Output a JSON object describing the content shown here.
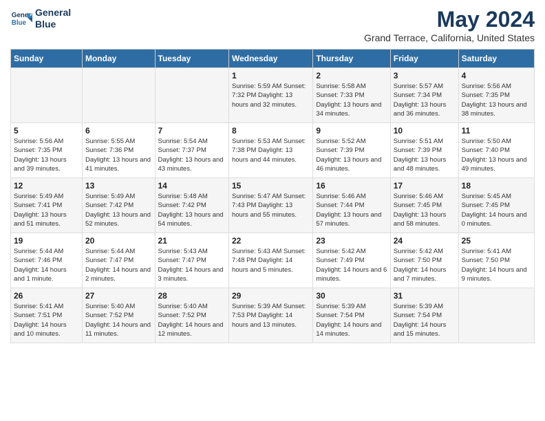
{
  "logo": {
    "line1": "General",
    "line2": "Blue"
  },
  "title": "May 2024",
  "subtitle": "Grand Terrace, California, United States",
  "days_of_week": [
    "Sunday",
    "Monday",
    "Tuesday",
    "Wednesday",
    "Thursday",
    "Friday",
    "Saturday"
  ],
  "weeks": [
    [
      {
        "day": "",
        "info": ""
      },
      {
        "day": "",
        "info": ""
      },
      {
        "day": "",
        "info": ""
      },
      {
        "day": "1",
        "info": "Sunrise: 5:59 AM\nSunset: 7:32 PM\nDaylight: 13 hours\nand 32 minutes."
      },
      {
        "day": "2",
        "info": "Sunrise: 5:58 AM\nSunset: 7:33 PM\nDaylight: 13 hours\nand 34 minutes."
      },
      {
        "day": "3",
        "info": "Sunrise: 5:57 AM\nSunset: 7:34 PM\nDaylight: 13 hours\nand 36 minutes."
      },
      {
        "day": "4",
        "info": "Sunrise: 5:56 AM\nSunset: 7:35 PM\nDaylight: 13 hours\nand 38 minutes."
      }
    ],
    [
      {
        "day": "5",
        "info": "Sunrise: 5:56 AM\nSunset: 7:35 PM\nDaylight: 13 hours\nand 39 minutes."
      },
      {
        "day": "6",
        "info": "Sunrise: 5:55 AM\nSunset: 7:36 PM\nDaylight: 13 hours\nand 41 minutes."
      },
      {
        "day": "7",
        "info": "Sunrise: 5:54 AM\nSunset: 7:37 PM\nDaylight: 13 hours\nand 43 minutes."
      },
      {
        "day": "8",
        "info": "Sunrise: 5:53 AM\nSunset: 7:38 PM\nDaylight: 13 hours\nand 44 minutes."
      },
      {
        "day": "9",
        "info": "Sunrise: 5:52 AM\nSunset: 7:39 PM\nDaylight: 13 hours\nand 46 minutes."
      },
      {
        "day": "10",
        "info": "Sunrise: 5:51 AM\nSunset: 7:39 PM\nDaylight: 13 hours\nand 48 minutes."
      },
      {
        "day": "11",
        "info": "Sunrise: 5:50 AM\nSunset: 7:40 PM\nDaylight: 13 hours\nand 49 minutes."
      }
    ],
    [
      {
        "day": "12",
        "info": "Sunrise: 5:49 AM\nSunset: 7:41 PM\nDaylight: 13 hours\nand 51 minutes."
      },
      {
        "day": "13",
        "info": "Sunrise: 5:49 AM\nSunset: 7:42 PM\nDaylight: 13 hours\nand 52 minutes."
      },
      {
        "day": "14",
        "info": "Sunrise: 5:48 AM\nSunset: 7:42 PM\nDaylight: 13 hours\nand 54 minutes."
      },
      {
        "day": "15",
        "info": "Sunrise: 5:47 AM\nSunset: 7:43 PM\nDaylight: 13 hours\nand 55 minutes."
      },
      {
        "day": "16",
        "info": "Sunrise: 5:46 AM\nSunset: 7:44 PM\nDaylight: 13 hours\nand 57 minutes."
      },
      {
        "day": "17",
        "info": "Sunrise: 5:46 AM\nSunset: 7:45 PM\nDaylight: 13 hours\nand 58 minutes."
      },
      {
        "day": "18",
        "info": "Sunrise: 5:45 AM\nSunset: 7:45 PM\nDaylight: 14 hours\nand 0 minutes."
      }
    ],
    [
      {
        "day": "19",
        "info": "Sunrise: 5:44 AM\nSunset: 7:46 PM\nDaylight: 14 hours\nand 1 minute."
      },
      {
        "day": "20",
        "info": "Sunrise: 5:44 AM\nSunset: 7:47 PM\nDaylight: 14 hours\nand 2 minutes."
      },
      {
        "day": "21",
        "info": "Sunrise: 5:43 AM\nSunset: 7:47 PM\nDaylight: 14 hours\nand 3 minutes."
      },
      {
        "day": "22",
        "info": "Sunrise: 5:43 AM\nSunset: 7:48 PM\nDaylight: 14 hours\nand 5 minutes."
      },
      {
        "day": "23",
        "info": "Sunrise: 5:42 AM\nSunset: 7:49 PM\nDaylight: 14 hours\nand 6 minutes."
      },
      {
        "day": "24",
        "info": "Sunrise: 5:42 AM\nSunset: 7:50 PM\nDaylight: 14 hours\nand 7 minutes."
      },
      {
        "day": "25",
        "info": "Sunrise: 5:41 AM\nSunset: 7:50 PM\nDaylight: 14 hours\nand 9 minutes."
      }
    ],
    [
      {
        "day": "26",
        "info": "Sunrise: 5:41 AM\nSunset: 7:51 PM\nDaylight: 14 hours\nand 10 minutes."
      },
      {
        "day": "27",
        "info": "Sunrise: 5:40 AM\nSunset: 7:52 PM\nDaylight: 14 hours\nand 11 minutes."
      },
      {
        "day": "28",
        "info": "Sunrise: 5:40 AM\nSunset: 7:52 PM\nDaylight: 14 hours\nand 12 minutes."
      },
      {
        "day": "29",
        "info": "Sunrise: 5:39 AM\nSunset: 7:53 PM\nDaylight: 14 hours\nand 13 minutes."
      },
      {
        "day": "30",
        "info": "Sunrise: 5:39 AM\nSunset: 7:54 PM\nDaylight: 14 hours\nand 14 minutes."
      },
      {
        "day": "31",
        "info": "Sunrise: 5:39 AM\nSunset: 7:54 PM\nDaylight: 14 hours\nand 15 minutes."
      },
      {
        "day": "",
        "info": ""
      }
    ]
  ]
}
